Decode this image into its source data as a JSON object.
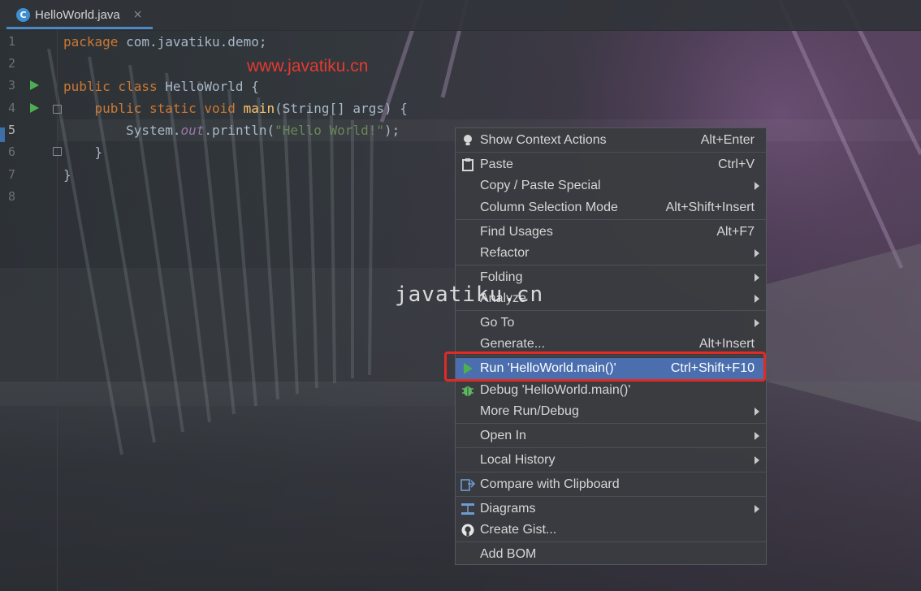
{
  "tab": {
    "filename": "HelloWorld.java",
    "icon_letter": "C",
    "close": "×"
  },
  "gutter": {
    "line_numbers": [
      "1",
      "2",
      "3",
      "4",
      "5",
      "6",
      "7",
      "8"
    ]
  },
  "code": {
    "line1": {
      "kw": "package",
      "rest": " com.javatiku.demo;"
    },
    "line3": {
      "kw": "public class",
      "name": " HelloWorld {"
    },
    "line4": {
      "indent": "    ",
      "kw": "public static void",
      "sp": " ",
      "fn": "main",
      "rest": "(String[] args) {"
    },
    "line5": {
      "indent": "        ",
      "pre": "System.",
      "field": "out",
      "mid": ".println(",
      "str": "\"Hello World!\"",
      "end": ");"
    },
    "line6": {
      "text": "    }"
    },
    "line7": {
      "text": "}"
    }
  },
  "watermarks": {
    "red": "www.javatiku.cn",
    "center": "javatiku.cn"
  },
  "menu": {
    "items": [
      {
        "label": "Show Context Actions",
        "shortcut": "Alt+Enter",
        "icon": "bulb-icon"
      },
      {
        "label": "Paste",
        "shortcut": "Ctrl+V",
        "icon": "clipboard-icon"
      },
      {
        "label": "Copy / Paste Special",
        "submenu": true
      },
      {
        "label": "Column Selection Mode",
        "shortcut": "Alt+Shift+Insert"
      },
      {
        "label": "Find Usages",
        "shortcut": "Alt+F7"
      },
      {
        "label": "Refactor",
        "submenu": true
      },
      {
        "label": "Folding",
        "submenu": true
      },
      {
        "label": "Analyze",
        "submenu": true
      },
      {
        "label": "Go To",
        "submenu": true
      },
      {
        "label": "Generate...",
        "shortcut": "Alt+Insert"
      },
      {
        "label": "Run 'HelloWorld.main()'",
        "shortcut": "Ctrl+Shift+F10",
        "icon": "run-icon",
        "selected": true
      },
      {
        "label": "Debug 'HelloWorld.main()'",
        "icon": "bug-icon"
      },
      {
        "label": "More Run/Debug",
        "submenu": true
      },
      {
        "label": "Open In",
        "submenu": true
      },
      {
        "label": "Local History",
        "submenu": true
      },
      {
        "label": "Compare with Clipboard",
        "icon": "compare-icon"
      },
      {
        "label": "Diagrams",
        "submenu": true,
        "icon": "diagram-icon"
      },
      {
        "label": "Create Gist...",
        "icon": "github-icon"
      },
      {
        "label": "Add BOM"
      }
    ]
  },
  "colors": {
    "accent": "#4b6eaf",
    "highlight": "#e02b24",
    "run": "#4caf50"
  }
}
